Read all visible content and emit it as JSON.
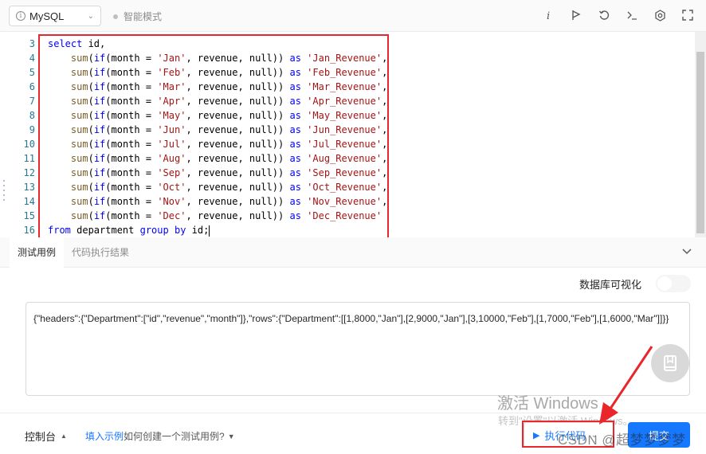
{
  "toolbar": {
    "language": "MySQL",
    "smart_mode": "智能模式",
    "icons": [
      "info-icon",
      "flag-icon",
      "reset-icon",
      "terminal-icon",
      "settings-icon",
      "fullscreen-icon"
    ]
  },
  "editor": {
    "lines": [
      {
        "n": "3",
        "tokens": [
          [
            "kw",
            "select"
          ],
          [
            "",
            " id,"
          ]
        ]
      },
      {
        "n": "4",
        "tokens": [
          [
            "",
            "    "
          ],
          [
            "fn",
            "sum"
          ],
          [
            "",
            "("
          ],
          [
            "kw",
            "if"
          ],
          [
            "",
            "(month = "
          ],
          [
            "str",
            "'Jan'"
          ],
          [
            "",
            ", revenue, null)) "
          ],
          [
            "kw",
            "as"
          ],
          [
            "",
            " "
          ],
          [
            "str",
            "'Jan_Revenue'"
          ],
          [
            "",
            ","
          ]
        ]
      },
      {
        "n": "5",
        "tokens": [
          [
            "",
            "    "
          ],
          [
            "fn",
            "sum"
          ],
          [
            "",
            "("
          ],
          [
            "kw",
            "if"
          ],
          [
            "",
            "(month = "
          ],
          [
            "str",
            "'Feb'"
          ],
          [
            "",
            ", revenue, null)) "
          ],
          [
            "kw",
            "as"
          ],
          [
            "",
            " "
          ],
          [
            "str",
            "'Feb_Revenue'"
          ],
          [
            "",
            ","
          ]
        ]
      },
      {
        "n": "6",
        "tokens": [
          [
            "",
            "    "
          ],
          [
            "fn",
            "sum"
          ],
          [
            "",
            "("
          ],
          [
            "kw",
            "if"
          ],
          [
            "",
            "(month = "
          ],
          [
            "str",
            "'Mar'"
          ],
          [
            "",
            ", revenue, null)) "
          ],
          [
            "kw",
            "as"
          ],
          [
            "",
            " "
          ],
          [
            "str",
            "'Mar_Revenue'"
          ],
          [
            "",
            ","
          ]
        ]
      },
      {
        "n": "7",
        "tokens": [
          [
            "",
            "    "
          ],
          [
            "fn",
            "sum"
          ],
          [
            "",
            "("
          ],
          [
            "kw",
            "if"
          ],
          [
            "",
            "(month = "
          ],
          [
            "str",
            "'Apr'"
          ],
          [
            "",
            ", revenue, null)) "
          ],
          [
            "kw",
            "as"
          ],
          [
            "",
            " "
          ],
          [
            "str",
            "'Apr_Revenue'"
          ],
          [
            "",
            ","
          ]
        ]
      },
      {
        "n": "8",
        "tokens": [
          [
            "",
            "    "
          ],
          [
            "fn",
            "sum"
          ],
          [
            "",
            "("
          ],
          [
            "kw",
            "if"
          ],
          [
            "",
            "(month = "
          ],
          [
            "str",
            "'May'"
          ],
          [
            "",
            ", revenue, null)) "
          ],
          [
            "kw",
            "as"
          ],
          [
            "",
            " "
          ],
          [
            "str",
            "'May_Revenue'"
          ],
          [
            "",
            ","
          ]
        ]
      },
      {
        "n": "9",
        "tokens": [
          [
            "",
            "    "
          ],
          [
            "fn",
            "sum"
          ],
          [
            "",
            "("
          ],
          [
            "kw",
            "if"
          ],
          [
            "",
            "(month = "
          ],
          [
            "str",
            "'Jun'"
          ],
          [
            "",
            ", revenue, null)) "
          ],
          [
            "kw",
            "as"
          ],
          [
            "",
            " "
          ],
          [
            "str",
            "'Jun_Revenue'"
          ],
          [
            "",
            ","
          ]
        ]
      },
      {
        "n": "10",
        "tokens": [
          [
            "",
            "    "
          ],
          [
            "fn",
            "sum"
          ],
          [
            "",
            "("
          ],
          [
            "kw",
            "if"
          ],
          [
            "",
            "(month = "
          ],
          [
            "str",
            "'Jul'"
          ],
          [
            "",
            ", revenue, null)) "
          ],
          [
            "kw",
            "as"
          ],
          [
            "",
            " "
          ],
          [
            "str",
            "'Jul_Revenue'"
          ],
          [
            "",
            ","
          ]
        ]
      },
      {
        "n": "11",
        "tokens": [
          [
            "",
            "    "
          ],
          [
            "fn",
            "sum"
          ],
          [
            "",
            "("
          ],
          [
            "kw",
            "if"
          ],
          [
            "",
            "(month = "
          ],
          [
            "str",
            "'Aug'"
          ],
          [
            "",
            ", revenue, null)) "
          ],
          [
            "kw",
            "as"
          ],
          [
            "",
            " "
          ],
          [
            "str",
            "'Aug_Revenue'"
          ],
          [
            "",
            ","
          ]
        ]
      },
      {
        "n": "12",
        "tokens": [
          [
            "",
            "    "
          ],
          [
            "fn",
            "sum"
          ],
          [
            "",
            "("
          ],
          [
            "kw",
            "if"
          ],
          [
            "",
            "(month = "
          ],
          [
            "str",
            "'Sep'"
          ],
          [
            "",
            ", revenue, null)) "
          ],
          [
            "kw",
            "as"
          ],
          [
            "",
            " "
          ],
          [
            "str",
            "'Sep_Revenue'"
          ],
          [
            "",
            ","
          ]
        ]
      },
      {
        "n": "13",
        "tokens": [
          [
            "",
            "    "
          ],
          [
            "fn",
            "sum"
          ],
          [
            "",
            "("
          ],
          [
            "kw",
            "if"
          ],
          [
            "",
            "(month = "
          ],
          [
            "str",
            "'Oct'"
          ],
          [
            "",
            ", revenue, null)) "
          ],
          [
            "kw",
            "as"
          ],
          [
            "",
            " "
          ],
          [
            "str",
            "'Oct_Revenue'"
          ],
          [
            "",
            ","
          ]
        ]
      },
      {
        "n": "14",
        "tokens": [
          [
            "",
            "    "
          ],
          [
            "fn",
            "sum"
          ],
          [
            "",
            "("
          ],
          [
            "kw",
            "if"
          ],
          [
            "",
            "(month = "
          ],
          [
            "str",
            "'Nov'"
          ],
          [
            "",
            ", revenue, null)) "
          ],
          [
            "kw",
            "as"
          ],
          [
            "",
            " "
          ],
          [
            "str",
            "'Nov_Revenue'"
          ],
          [
            "",
            ","
          ]
        ]
      },
      {
        "n": "15",
        "tokens": [
          [
            "",
            "    "
          ],
          [
            "fn",
            "sum"
          ],
          [
            "",
            "("
          ],
          [
            "kw",
            "if"
          ],
          [
            "",
            "(month = "
          ],
          [
            "str",
            "'Dec'"
          ],
          [
            "",
            ", revenue, null)) "
          ],
          [
            "kw",
            "as"
          ],
          [
            "",
            " "
          ],
          [
            "str",
            "'Dec_Revenue'"
          ]
        ]
      },
      {
        "n": "16",
        "tokens": [
          [
            "kw",
            "from"
          ],
          [
            "",
            " department "
          ],
          [
            "kw",
            "group"
          ],
          [
            "",
            " "
          ],
          [
            "kw",
            "by"
          ],
          [
            "",
            " id;"
          ]
        ]
      }
    ]
  },
  "tabs": [
    {
      "label": "测试用例"
    },
    {
      "label": "代码执行结果"
    }
  ],
  "db_viz_label": "数据库可视化",
  "test_case_text": "{\"headers\":{\"Department\":[\"id\",\"revenue\",\"month\"]},\"rows\":{\"Department\":[[1,8000,\"Jan\"],[2,9000,\"Jan\"],[3,10000,\"Feb\"],[1,7000,\"Feb\"],[1,6000,\"Mar\"]]}}",
  "watermark": {
    "line1": "激活 Windows",
    "line2": "转到\"设置\"以激活 Windows。"
  },
  "bottom": {
    "console": "控制台",
    "fill_example": "填入示例",
    "how_to": "如何创建一个测试用例?",
    "run_code": "执行代码",
    "submit": "提交",
    "csdn": "CSDN @超梦梦梦梦"
  },
  "colors": {
    "accent": "#1677ff",
    "highlight_red": "#e8262b"
  }
}
